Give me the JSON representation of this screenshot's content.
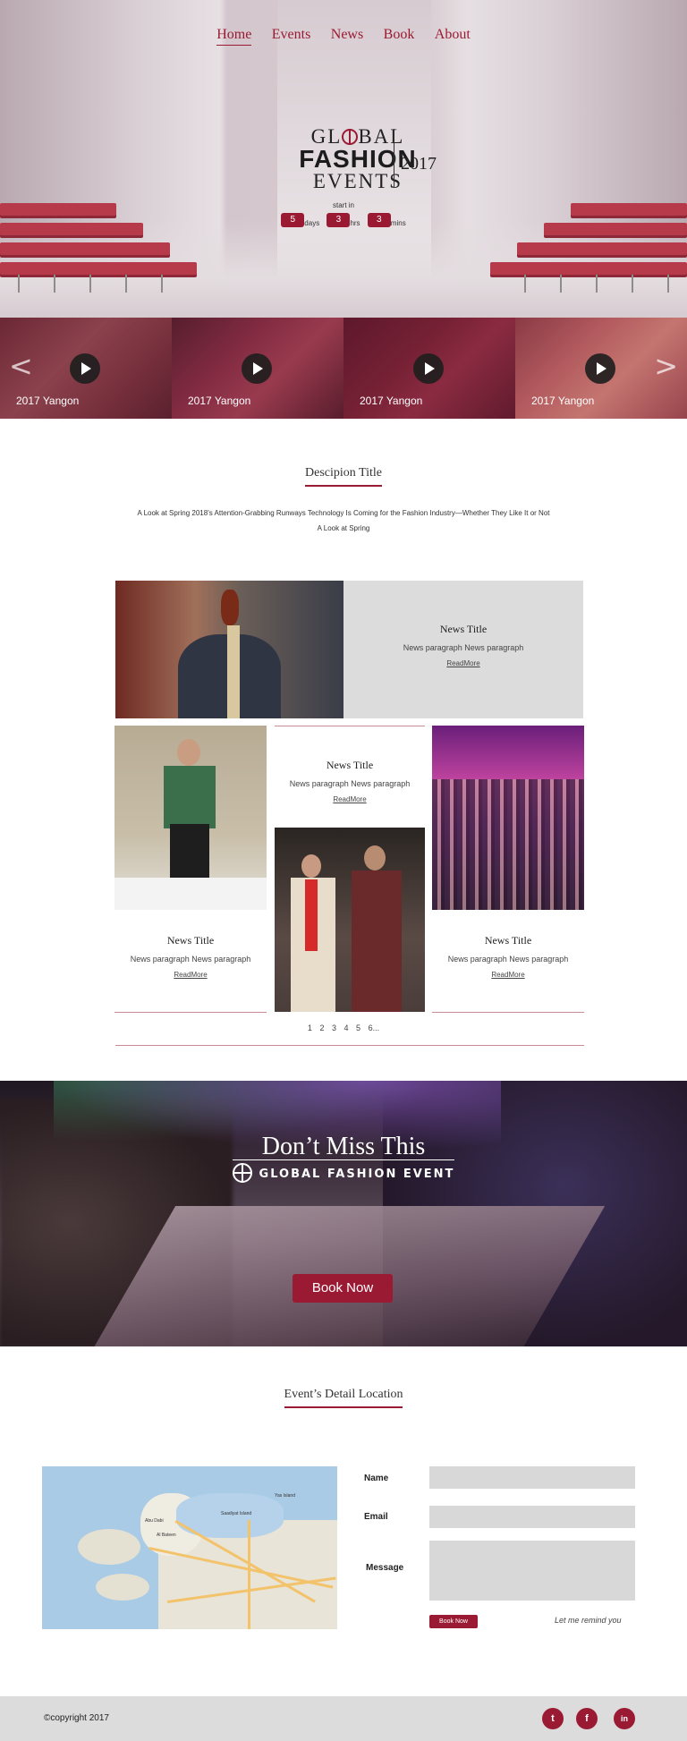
{
  "nav": {
    "items": [
      {
        "label": "Home",
        "active": true
      },
      {
        "label": "Events"
      },
      {
        "label": "News"
      },
      {
        "label": "Book"
      },
      {
        "label": "About"
      }
    ]
  },
  "hero": {
    "logo_line1": "GL BAL",
    "logo_line2": "FASHION",
    "logo_line3": "EVENTS",
    "logo_year": "2017",
    "start_in": "start in",
    "countdown": [
      {
        "value": "5",
        "unit": "days"
      },
      {
        "value": "3",
        "unit": "hrs"
      },
      {
        "value": "3",
        "unit": "mins"
      }
    ]
  },
  "videos": [
    {
      "caption": "2017 Yangon"
    },
    {
      "caption": "2017 Yangon"
    },
    {
      "caption": "2017 Yangon"
    },
    {
      "caption": "2017 Yangon"
    }
  ],
  "arrows": {
    "prev": "<",
    "next": ">"
  },
  "description": {
    "title": "Descipion Title",
    "text": "A Look at Spring 2018's Attention-Grabbing Runways Technology Is Coming for the Fashion Industry—Whether They Like It or Not A Look at Spring"
  },
  "news": [
    {
      "title": "News Title",
      "paragraph": "News paragraph News paragraph",
      "link": "ReadMore"
    },
    {
      "title": "News Title",
      "paragraph": "News paragraph News paragraph",
      "link": "ReadMore"
    },
    {
      "title": "News Title",
      "paragraph": "News paragraph News paragraph",
      "link": "ReadMore"
    },
    {
      "title": "News Title",
      "paragraph": "News paragraph News paragraph",
      "link": "ReadMore"
    }
  ],
  "pager": [
    "1",
    "2",
    "3",
    "4",
    "5",
    "6..."
  ],
  "banner": {
    "headline": "Don’t Miss This",
    "subline": "GLOBAL FASHION EVENT",
    "button": "Book Now"
  },
  "location": {
    "title": "Event’s  Detail  Location",
    "map_labels": [
      "Abu Dabi",
      "Al Bateen",
      "Saadiyat Island",
      "Yas Island"
    ],
    "form": {
      "name_label": "Name",
      "email_label": "Email",
      "message_label": "Message",
      "send_button": "Book Now",
      "remind": "Let me remind you"
    }
  },
  "footer": {
    "copyright": "©copyright 2017",
    "social": [
      {
        "icon": "tumblr-icon",
        "glyph": "t"
      },
      {
        "icon": "facebook-icon",
        "glyph": "f"
      },
      {
        "icon": "linkedin-icon",
        "glyph": "in"
      }
    ]
  },
  "colors": {
    "accent": "#9b1a33",
    "footer_bg": "#dcdcdc",
    "field_bg": "#d8d8d8"
  }
}
